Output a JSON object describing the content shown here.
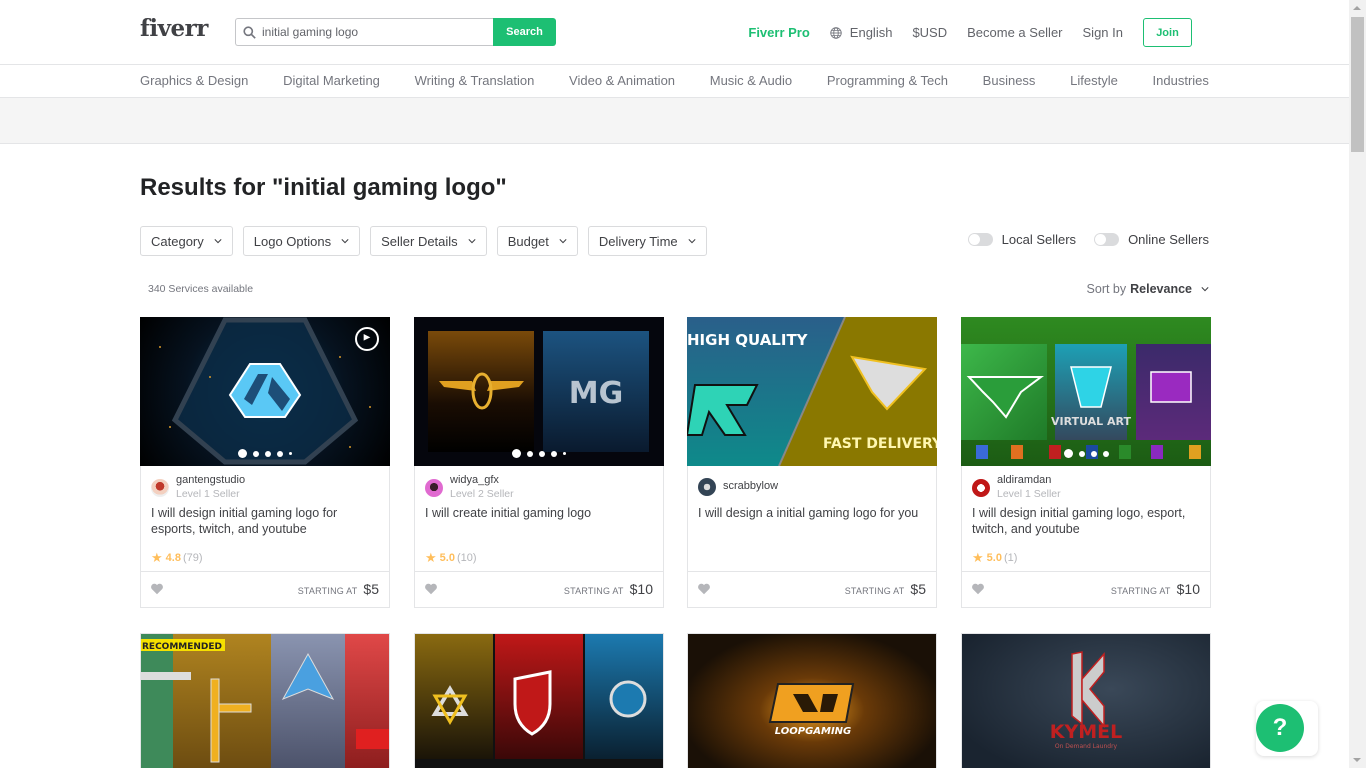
{
  "header": {
    "logo": "fiverr",
    "search": {
      "value": "initial gaming logo",
      "button": "Search"
    },
    "nav": {
      "pro": "Fiverr Pro",
      "language": "English",
      "currency": "$USD",
      "become_seller": "Become a Seller",
      "sign_in": "Sign In",
      "join": "Join"
    }
  },
  "categories": [
    "Graphics & Design",
    "Digital Marketing",
    "Writing & Translation",
    "Video & Animation",
    "Music & Audio",
    "Programming & Tech",
    "Business",
    "Lifestyle",
    "Industries"
  ],
  "page_title": "Results for \"initial gaming logo\"",
  "filters": [
    "Category",
    "Logo Options",
    "Seller Details",
    "Budget",
    "Delivery Time"
  ],
  "toggles": {
    "local": "Local Sellers",
    "online": "Online Sellers"
  },
  "results_count": "340 Services available",
  "sort": {
    "label": "Sort by",
    "value": "Relevance"
  },
  "price_label": "STARTING AT",
  "gigs": [
    {
      "seller": "gantengstudio",
      "level": "Level 1 Seller",
      "title": "I will design initial gaming logo for esports, twitch, and youtube",
      "rating": "4.8",
      "reviews": "(79)",
      "price": "$5"
    },
    {
      "seller": "widya_gfx",
      "level": "Level 2 Seller",
      "title": "I will create initial gaming logo",
      "rating": "5.0",
      "reviews": "(10)",
      "price": "$10"
    },
    {
      "seller": "scrabbylow",
      "level": "",
      "title": "I will design a initial gaming logo for you",
      "rating": "",
      "reviews": "",
      "price": "$5"
    },
    {
      "seller": "aldiramdan",
      "level": "Level 1 Seller",
      "title": "I will design initial gaming logo, esport, twitch, and youtube",
      "rating": "5.0",
      "reviews": "(1)",
      "price": "$10"
    }
  ],
  "thumb_text": {
    "card3_top": "HIGH QUALITY",
    "card3_bottom": "FAST DELIVERY",
    "card4_center": "VIRTUAL ART",
    "row2_badge": "RECOMMENDED",
    "row2_card3": "LOOPGAMING",
    "row2_card4": "KYMEL",
    "row2_card4_sub": "On Demand Laundry"
  },
  "help": "?"
}
